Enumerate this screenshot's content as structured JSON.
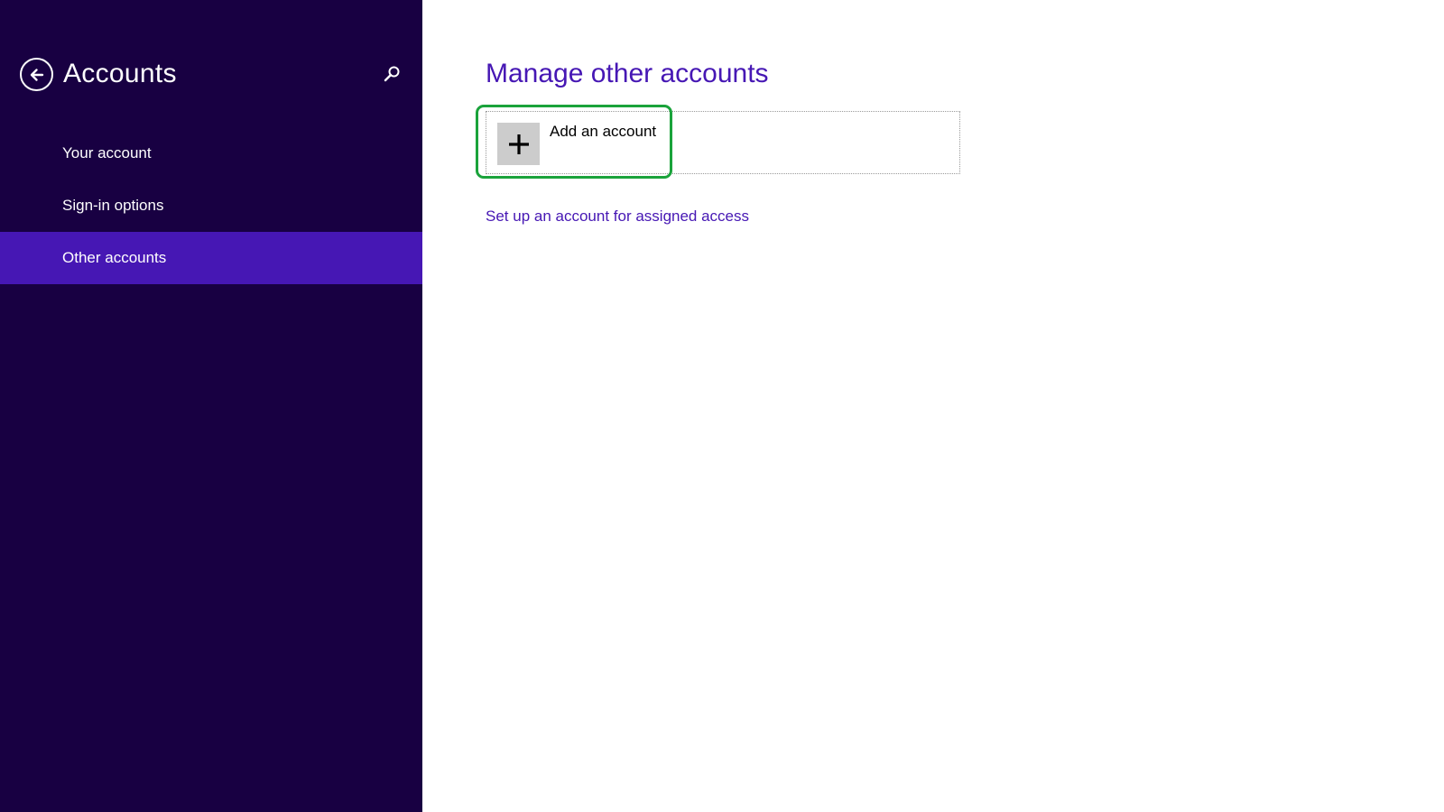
{
  "colors": {
    "sidebar_bg": "#180042",
    "accent": "#4617b4",
    "highlight": "#1aa33b"
  },
  "sidebar": {
    "back_icon": "back-arrow-icon",
    "title": "Accounts",
    "search_icon": "search-icon",
    "items": [
      {
        "label": "Your account",
        "active": false
      },
      {
        "label": "Sign-in options",
        "active": false
      },
      {
        "label": "Other accounts",
        "active": true
      }
    ]
  },
  "main": {
    "title": "Manage other accounts",
    "add_account": {
      "icon": "plus-icon",
      "label": "Add an account"
    },
    "assigned_access_link": "Set up an account for assigned access"
  }
}
